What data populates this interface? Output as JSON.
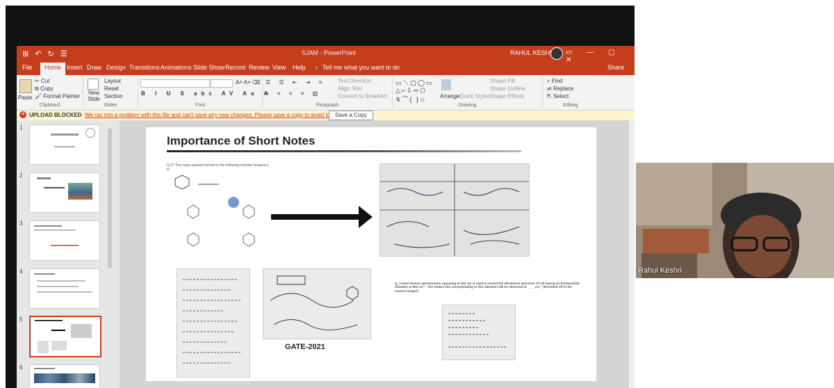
{
  "app": {
    "title": "SJAM  -  PowerPoint",
    "user_name": "RAHUL KESHRI",
    "quick_access": "⊞ ↶ ↻ ☰",
    "window_controls": "▭ — ▢ ✕"
  },
  "tabs": [
    {
      "label": "File"
    },
    {
      "label": "Home"
    },
    {
      "label": "Insert"
    },
    {
      "label": "Draw"
    },
    {
      "label": "Design"
    },
    {
      "label": "Transitions"
    },
    {
      "label": "Animations"
    },
    {
      "label": "Slide Show"
    },
    {
      "label": "Record"
    },
    {
      "label": "Review"
    },
    {
      "label": "View"
    },
    {
      "label": "Help"
    }
  ],
  "tell_me": "Tell me what you want to do",
  "share": "Share",
  "ribbon": {
    "clipboard": {
      "label": "Clipboard",
      "paste": "Paste",
      "cut": "Cut",
      "copy": "Copy",
      "format_painter": "Format Painter"
    },
    "slides": {
      "label": "Slides",
      "new_slide": "New Slide",
      "layout": "Layout",
      "reset": "Reset",
      "section": "Section"
    },
    "font": {
      "label": "Font"
    },
    "paragraph": {
      "label": "Paragraph",
      "text_direction": "Text Direction",
      "align_text": "Align Text",
      "convert_smartart": "Convert to SmartArt"
    },
    "drawing": {
      "label": "Drawing",
      "arrange": "Arrange",
      "quick_styles": "Quick Styles",
      "shape_fill": "Shape Fill",
      "shape_outline": "Shape Outline",
      "shape_effects": "Shape Effects"
    },
    "editing": {
      "label": "Editing",
      "find": "Find",
      "replace": "Replace",
      "select": "Select"
    }
  },
  "message_bar": {
    "title": "UPLOAD BLOCKED",
    "text": "We ran into a problem with this file and can't save any new changes. Please save a copy to avoid losing your work.",
    "button": "Save a Copy"
  },
  "thumbnails": [
    {
      "num": "1"
    },
    {
      "num": "2"
    },
    {
      "num": "3"
    },
    {
      "num": "4"
    },
    {
      "num": "5"
    },
    {
      "num": "6"
    }
  ],
  "slide": {
    "title": "Importance of Short Notes",
    "question1": "Q.37  The major product formed in the following reaction sequence is",
    "question2": "Q.  A laser Raman spectrometer operating at 532 nm is used to record the vibrational spectrum of Cl2 having its fundamental vibration at 560 cm⁻¹. The Stokes line corresponding to this vibration will be observed at ____ cm⁻¹ (Rounded off to the nearest integer)",
    "gate_label": "GATE-2021"
  },
  "webcam": {
    "name": "Rahul Keshri"
  }
}
